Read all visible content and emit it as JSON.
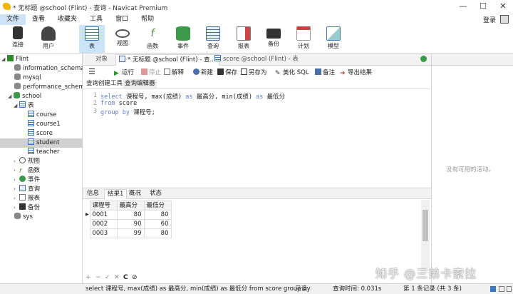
{
  "window": {
    "title": "* 无标题 @school (Flint) - 查询 - Navicat Premium",
    "controls": [
      "—",
      "☐",
      "✕"
    ]
  },
  "menu": {
    "items": [
      "文件",
      "查看",
      "收藏夹",
      "工具",
      "窗口",
      "帮助"
    ],
    "login": "登录"
  },
  "toolbar": {
    "items": [
      {
        "label": "连接",
        "color": "#333333"
      },
      {
        "label": "用户",
        "color": "#444444"
      },
      {
        "label": "表",
        "color": "#3a78c3"
      },
      {
        "label": "视图",
        "color": "#555555"
      },
      {
        "label": "函数",
        "color": "#4a8c3a"
      },
      {
        "label": "事件",
        "color": "#3a9a4a"
      },
      {
        "label": "查询",
        "color": "#4a6ea8"
      },
      {
        "label": "报表",
        "color": "#777777"
      },
      {
        "label": "备份",
        "color": "#333333"
      },
      {
        "label": "计划",
        "color": "#c94040"
      },
      {
        "label": "模型",
        "color": "#3a78c3"
      }
    ]
  },
  "tree": {
    "connection": "Flint",
    "databases": [
      "information_schema",
      "mysql",
      "performance_schema"
    ],
    "school": "school",
    "tables_group": "表",
    "tables": [
      "course",
      "course1",
      "score",
      "student",
      "teacher"
    ],
    "groups": [
      "视图",
      "函数",
      "事件",
      "查询",
      "报表",
      "备份"
    ],
    "sys": "sys"
  },
  "tabs": {
    "objects": "对象",
    "query_tab": "* 无标题 @school (Flint) - 查...",
    "score_tab": "score @school (Flint) - 表"
  },
  "query_toolbar": {
    "run": "运行",
    "stop": "停止",
    "explain": "解释",
    "new": "新建",
    "save": "保存",
    "save_as": "另存为",
    "beautify": "美化 SQL",
    "notes": "备注",
    "export": "导出结果"
  },
  "subtabs": [
    "查询创建工具",
    "查询编辑器"
  ],
  "editor": {
    "line_numbers": [
      "1",
      "2",
      "3"
    ],
    "line1_kw1": "select",
    "line1_mid1": " 课程号, max(成绩) ",
    "line1_kw2": "as",
    "line1_mid2": " 最高分, min(成绩) ",
    "line1_kw3": "as",
    "line1_end": " 最低分",
    "line2_kw": "from",
    "line2_end": " score",
    "line3_kw": "group by",
    "line3_end": " 课程号;"
  },
  "result_tabs": [
    "信息",
    "结果1",
    "概况",
    "状态"
  ],
  "results": {
    "columns": [
      "课程号",
      "最高分",
      "最低分"
    ],
    "rows": [
      [
        "0001",
        "80",
        "80"
      ],
      [
        "0002",
        "90",
        "60"
      ],
      [
        "0003",
        "99",
        "80"
      ]
    ]
  },
  "grid_controls": [
    "+",
    "−",
    "✓",
    "✕",
    "C",
    "⊘"
  ],
  "right_panel": {
    "empty_text": "没有可用的活动。"
  },
  "watermark": "知乎 @三弟卡索拉",
  "status": {
    "sql": "select 课程号, max(成绩) as 最高分, min(成绩) as 最低分 from score group by",
    "readonly": "只读",
    "query_time": "查询时间: 0.031s",
    "records": "第 1 条记录 (共 3 条)"
  }
}
